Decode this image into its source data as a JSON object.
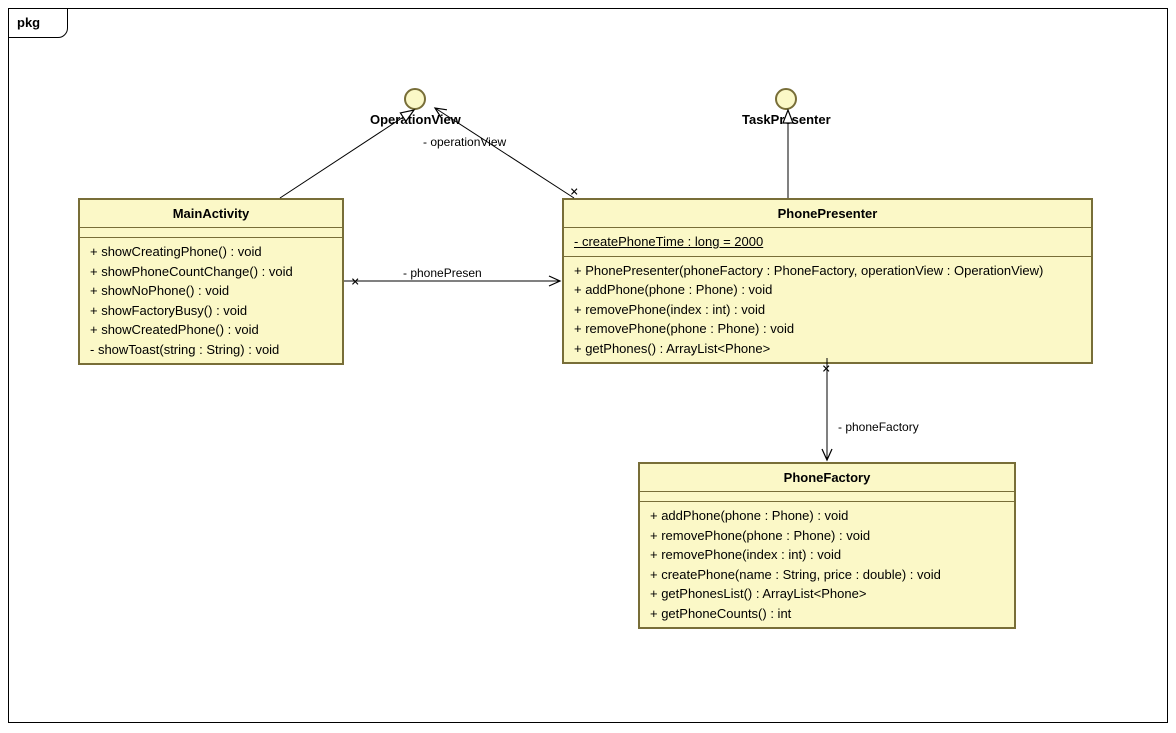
{
  "package": {
    "label": "pkg"
  },
  "interfaces": {
    "operationView": {
      "name": "OperationView",
      "roleLabel": "- operationView"
    },
    "taskPresenter": {
      "name": "TaskPresenter"
    }
  },
  "classes": {
    "mainActivity": {
      "name": "MainActivity",
      "operations": [
        "+ showCreatingPhone() : void",
        "+ showPhoneCountChange() : void",
        "+ showNoPhone() : void",
        "+ showFactoryBusy() : void",
        "+ showCreatedPhone() : void",
        "- showToast(string : String) : void"
      ]
    },
    "phonePresenter": {
      "name": "PhonePresenter",
      "attributes": [
        "- createPhoneTime : long = 2000"
      ],
      "operations": [
        "+ PhonePresenter(phoneFactory : PhoneFactory, operationView : OperationView)",
        "+ addPhone(phone : Phone) : void",
        "+ removePhone(index : int) : void",
        "+ removePhone(phone : Phone) : void",
        "+ getPhones() : ArrayList<Phone>"
      ]
    },
    "phoneFactory": {
      "name": "PhoneFactory",
      "operations": [
        "+ addPhone(phone : Phone) : void",
        "+ removePhone(phone : Phone) : void",
        "+ removePhone(index : int) : void",
        "+ createPhone(name : String, price : double) : void",
        "+ getPhonesList() : ArrayList<Phone>",
        "+ getPhoneCounts() : int"
      ]
    }
  },
  "associations": {
    "phonePresenterRole": "- phonePresen",
    "phoneFactoryRole": "- phoneFactory"
  }
}
